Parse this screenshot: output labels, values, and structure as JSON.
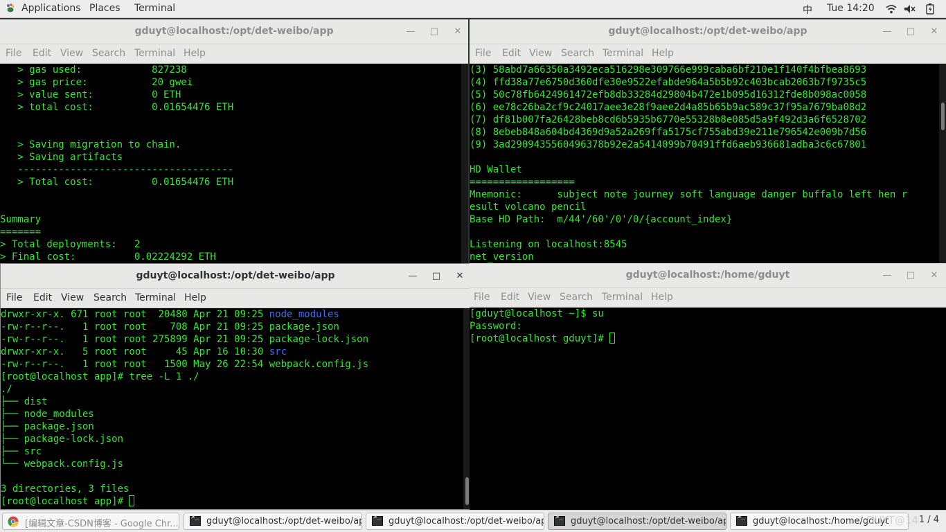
{
  "topbar": {
    "applications": "Applications",
    "places": "Places",
    "terminal": "Terminal",
    "input_method": "中",
    "clock": "Tue 14:20"
  },
  "menus": [
    "File",
    "Edit",
    "View",
    "Search",
    "Terminal",
    "Help"
  ],
  "windows": {
    "top_left": {
      "title": "gduyt@localhost:/opt/det-weibo/app",
      "lines": [
        "   > gas used:            827238",
        "   > gas price:           20 gwei",
        "   > value sent:          0 ETH",
        "   > total cost:          0.01654476 ETH",
        "",
        "",
        "   > Saving migration to chain.",
        "   > Saving artifacts",
        "   -------------------------------------",
        "   > Total cost:          0.01654476 ETH",
        "",
        "",
        "Summary",
        "=======",
        "> Total deployments:   2",
        "> Final cost:          0.02224292 ETH"
      ]
    },
    "top_right": {
      "title": "gduyt@localhost:/opt/det-weibo/app",
      "lines": [
        "(3) 58abd7a66350a3492eca516298e309766e999caba6bf210e1f140f4bfbea8693",
        "(4) ffd38a77e6750d360dfe30e9522efabde964a5b5b92c403bcab2063b7f9735c5",
        "(5) 50c78fb6424961472efb8db33284d29804b472e1b095d16312fde8b098ac0058",
        "(6) ee78c26ba2cf9c24017aee3e28f9aee2d4a85b65b9ac589c37f95a7679ba08d2",
        "(7) df81b007fa26428beb8cd6b5935b6770e55328b8e085d5a9f492d3a6f6528702",
        "(8) 8ebeb848a604bd4369d9a52a269ffa5175cf755abd39e211e796542e009b7d56",
        "(9) 3ad2909435560496378b92e2a5414099b70491ffd6aeb936681adba3c6c67801",
        "",
        "HD Wallet",
        "==================",
        "Mnemonic:      subject note journey soft language danger buffalo left hen r",
        "esult volcano pencil",
        "Base HD Path:  m/44'/60'/0'/0/{account_index}",
        "",
        "Listening on localhost:8545",
        "net_version"
      ]
    },
    "bottom_left": {
      "title": "gduyt@localhost:/opt/det-weibo/app",
      "ls": [
        {
          "prefix": "drwxr-xr-x. 671 root root  20480 Apr 21 09:25 ",
          "name": "node_modules",
          "dir": true
        },
        {
          "prefix": "-rw-r--r--.   1 root root    708 Apr 21 09:25 ",
          "name": "package.json",
          "dir": false
        },
        {
          "prefix": "-rw-r--r--.   1 root root 275899 Apr 21 09:25 ",
          "name": "package-lock.json",
          "dir": false
        },
        {
          "prefix": "drwxr-xr-x.   5 root root     45 Apr 16 10:30 ",
          "name": "src",
          "dir": true
        },
        {
          "prefix": "-rw-r--r--.   1 root root   1500 May 26 22:54 ",
          "name": "webpack.config.js",
          "dir": false
        }
      ],
      "lines": [
        "[root@localhost app]# tree -L 1 ./",
        "./",
        "├── dist",
        "├── node_modules",
        "├── package.json",
        "├── package-lock.json",
        "├── src",
        "└── webpack.config.js",
        "",
        "3 directories, 3 files"
      ],
      "prompt": "[root@localhost app]# "
    },
    "bottom_right": {
      "title": "gduyt@localhost:/home/gduyt",
      "lines": [
        "[gduyt@localhost ~]$ su",
        "Password:"
      ],
      "prompt": "[root@localhost gduyt]# "
    }
  },
  "taskbar": {
    "items": [
      "[编辑文章-CSDN博客 - Google Chr...",
      "gduyt@localhost:/opt/det-weibo/app",
      "gduyt@localhost:/opt/det-weibo/app",
      "gduyt@localhost:/opt/det-weibo/app",
      "gduyt@localhost:/home/gduyt"
    ],
    "pager": "1 / 4",
    "watermark": "DUYT@14"
  },
  "colors": {
    "terminal_fg": "#33e633",
    "terminal_bg": "#000000",
    "directory_blue": "#3b6ef5"
  }
}
